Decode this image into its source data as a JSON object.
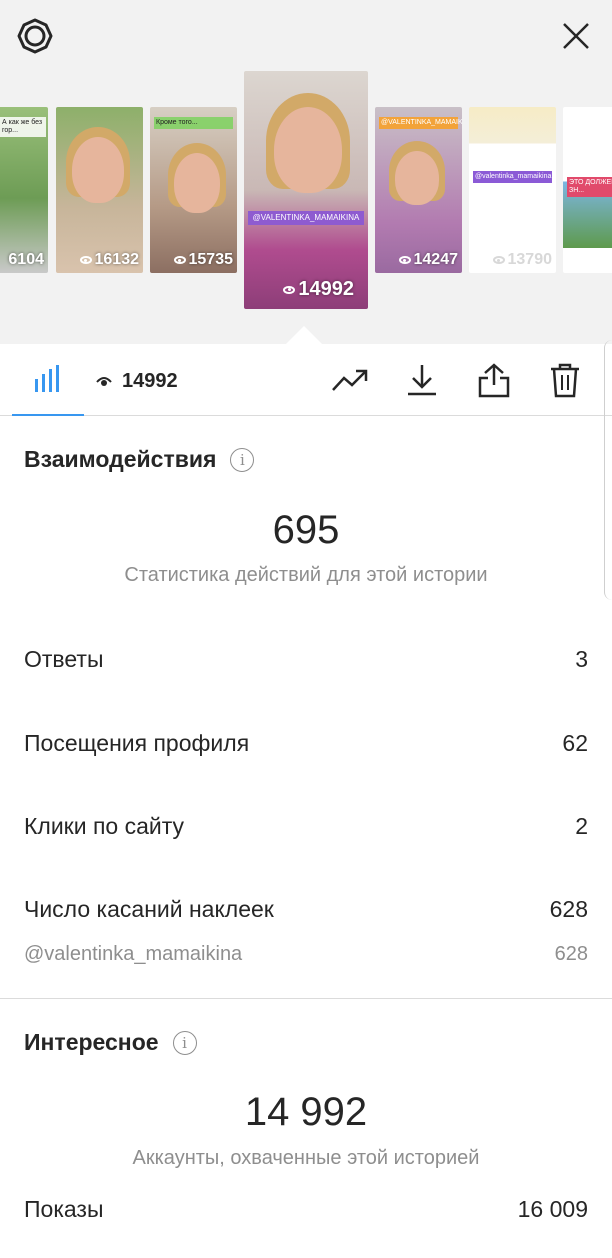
{
  "gallery": {
    "thumbnails": [
      {
        "count": "6104",
        "caption": "А как же без гор..."
      },
      {
        "count": "16132",
        "caption": ""
      },
      {
        "count": "15735",
        "caption": "Кроме того..."
      },
      {
        "count": "14992",
        "caption": "@VALENTINKA_MAMAIKINA",
        "selected": true
      },
      {
        "count": "14247",
        "caption": "@VALENTINKA_MAMAIKINA"
      },
      {
        "count": "13790",
        "caption": "@valentinka_mamaikina"
      },
      {
        "count": "",
        "caption": "ЭТО ДОЛЖЕН ЗН..."
      }
    ]
  },
  "toolbar": {
    "views": "14992",
    "icons": [
      "bar-chart-icon",
      "eye-icon",
      "trend-icon",
      "download-icon",
      "share-icon",
      "trash-icon"
    ]
  },
  "interactions": {
    "title": "Взаимодействия",
    "total": "695",
    "subtitle": "Статистика действий для этой истории",
    "rows": [
      {
        "label": "Ответы",
        "value": "3"
      },
      {
        "label": "Посещения профиля",
        "value": "62"
      },
      {
        "label": "Клики по сайту",
        "value": "2"
      },
      {
        "label": "Число касаний наклеек",
        "value": "628"
      }
    ],
    "sub_row": {
      "label": "@valentinka_mamaikina",
      "value": "628"
    }
  },
  "discovery": {
    "title": "Интересное",
    "total": "14 992",
    "subtitle": "Аккаунты, охваченные этой историей",
    "rows": [
      {
        "label": "Показы",
        "value": "16 009"
      }
    ]
  },
  "colors": {
    "accent": "#3897f0",
    "text": "#262626",
    "secondary": "#8e8e8e",
    "divider": "#dbdbdb"
  }
}
